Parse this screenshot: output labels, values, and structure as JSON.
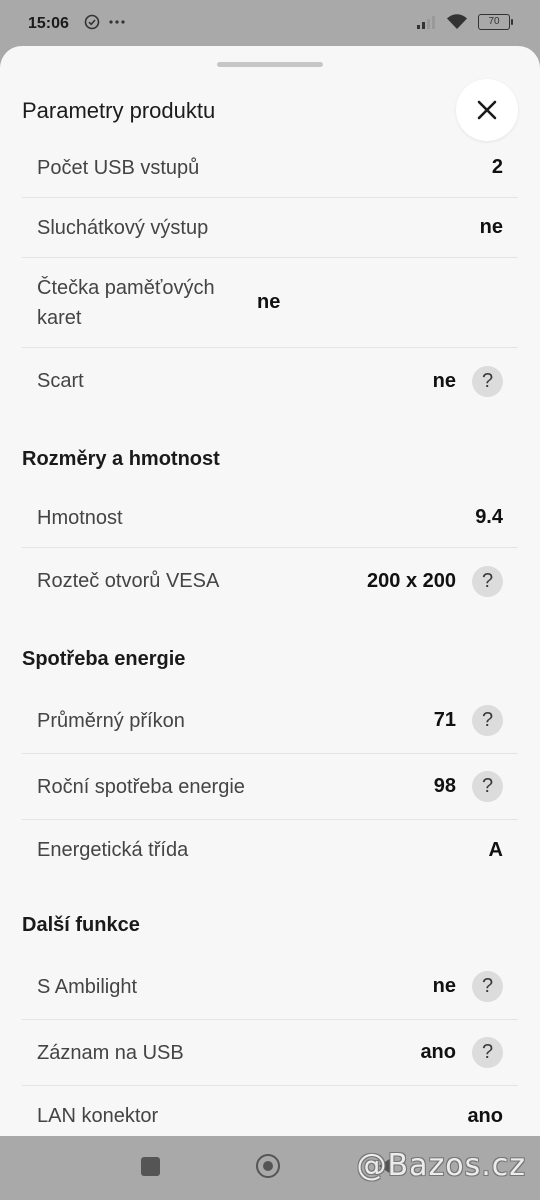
{
  "status": {
    "time": "15:06",
    "battery": "70"
  },
  "sheet": {
    "title": "Parametry produktu"
  },
  "groups": [
    {
      "title": "",
      "rows": [
        {
          "label": "Počet USB vstupů",
          "value": "2",
          "help": false
        },
        {
          "label": "Sluchátkový výstup",
          "value": "ne",
          "help": false
        },
        {
          "label": "Čtečka paměťových karet",
          "value": "ne",
          "help": false
        },
        {
          "label": "Scart",
          "value": "ne",
          "help": true
        }
      ]
    },
    {
      "title": "Rozměry a hmotnost",
      "rows": [
        {
          "label": "Hmotnost",
          "value": "9.4",
          "help": false
        },
        {
          "label": "Rozteč otvorů VESA",
          "value": "200 x 200",
          "help": true
        }
      ]
    },
    {
      "title": "Spotřeba energie",
      "rows": [
        {
          "label": "Průměrný příkon",
          "value": "71",
          "help": true
        },
        {
          "label": "Roční spotřeba energie",
          "value": "98",
          "help": true
        },
        {
          "label": "Energetická třída",
          "value": "A",
          "help": false
        }
      ]
    },
    {
      "title": "Další funkce",
      "rows": [
        {
          "label": "S Ambilight",
          "value": "ne",
          "help": true
        },
        {
          "label": "Záznam na USB",
          "value": "ano",
          "help": true
        },
        {
          "label": "LAN konektor",
          "value": "ano",
          "help": false
        }
      ]
    }
  ],
  "help_symbol": "?",
  "watermark": "@Bazos.cz"
}
